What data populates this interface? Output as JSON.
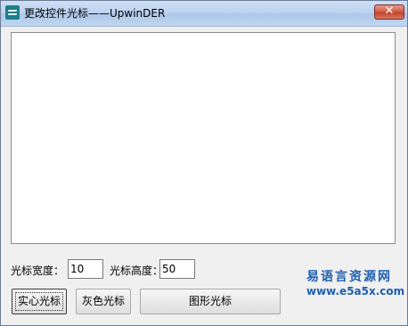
{
  "window": {
    "title": "更改控件光标——UpwinDER",
    "close_glyph": "✕"
  },
  "width_label": "光标宽度：",
  "width_value": "10",
  "height_label": "光标高度：",
  "height_value": "50",
  "buttons": {
    "solid": "实心光标",
    "gray": "灰色光标",
    "bitmap": "图形光标"
  },
  "watermark": {
    "line1": "易语言资源网",
    "line2": "www.e5a5x.com"
  }
}
